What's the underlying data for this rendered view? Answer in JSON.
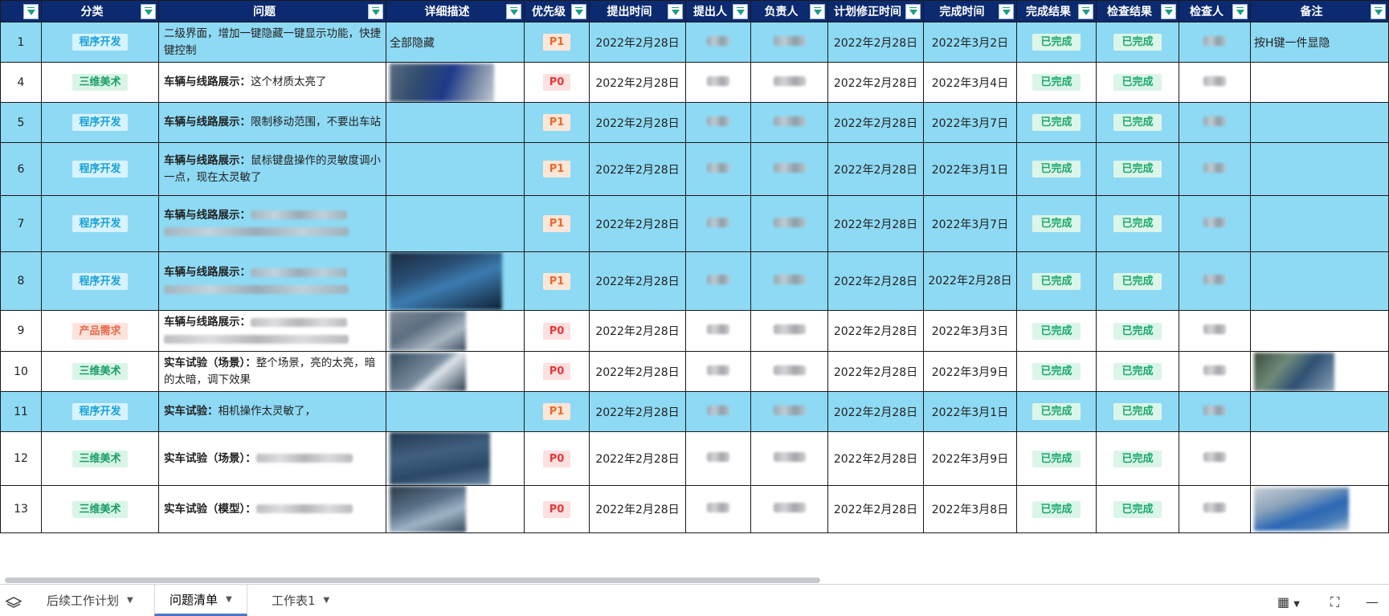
{
  "columns": [
    "",
    "分类",
    "问题",
    "详细描述",
    "优先级",
    "提出时间",
    "提出人",
    "负责人",
    "计划修正时间",
    "完成时间",
    "完成结果",
    "检查结果",
    "检查人",
    "备注"
  ],
  "rows": [
    {
      "no": "1",
      "hl": true,
      "cat": "程序开发",
      "cat_type": "dev",
      "q_bold": "",
      "q_text": "二级界面，增加一键隐藏一键显示功能，快捷键控制",
      "desc": "全部隐藏",
      "pri": "P1",
      "date": "2022年2月28日",
      "plan": "2022年2月28日",
      "finish": "2022年3月2日",
      "result": "已完成",
      "check": "已完成",
      "note": "按H键一件显隐"
    },
    {
      "no": "4",
      "hl": false,
      "cat": "三维美术",
      "cat_type": "art",
      "q_bold": "车辆与线路展示：",
      "q_text": "这个材质太亮了",
      "desc": "",
      "pri": "P0",
      "date": "2022年2月28日",
      "plan": "2022年2月28日",
      "finish": "2022年3月4日",
      "result": "已完成",
      "check": "已完成",
      "note": ""
    },
    {
      "no": "5",
      "hl": true,
      "cat": "程序开发",
      "cat_type": "dev",
      "q_bold": "车辆与线路展示：",
      "q_text": "限制移动范围，不要出车站",
      "desc": "",
      "pri": "P1",
      "date": "2022年2月28日",
      "plan": "2022年2月28日",
      "finish": "2022年3月7日",
      "result": "已完成",
      "check": "已完成",
      "note": ""
    },
    {
      "no": "6",
      "hl": true,
      "cat": "程序开发",
      "cat_type": "dev",
      "q_bold": "车辆与线路展示：",
      "q_text": "鼠标键盘操作的灵敏度调小一点，现在太灵敏了",
      "desc": "",
      "pri": "P1",
      "date": "2022年2月28日",
      "plan": "2022年2月28日",
      "finish": "2022年3月1日",
      "result": "已完成",
      "check": "已完成",
      "note": ""
    },
    {
      "no": "7",
      "hl": true,
      "cat": "程序开发",
      "cat_type": "dev",
      "q_bold": "车辆与线路展示：",
      "q_text": "",
      "desc": "",
      "pri": "P1",
      "date": "2022年2月28日",
      "plan": "2022年2月28日",
      "finish": "2022年3月7日",
      "result": "已完成",
      "check": "已完成",
      "note": ""
    },
    {
      "no": "8",
      "hl": true,
      "cat": "程序开发",
      "cat_type": "dev",
      "q_bold": "车辆与线路展示：",
      "q_text": "",
      "desc": "",
      "pri": "P1",
      "date": "2022年2月28日",
      "plan": "2022年2月28日",
      "finish": "2022年2月28日",
      "result": "已完成",
      "check": "已完成",
      "note": ""
    },
    {
      "no": "9",
      "hl": false,
      "cat": "产品需求",
      "cat_type": "prod",
      "q_bold": "车辆与线路展示：",
      "q_text": "",
      "desc": "",
      "pri": "P0",
      "date": "2022年2月28日",
      "plan": "2022年2月28日",
      "finish": "2022年3月3日",
      "result": "已完成",
      "check": "已完成",
      "note": ""
    },
    {
      "no": "10",
      "hl": false,
      "cat": "三维美术",
      "cat_type": "art",
      "q_bold": "实车试验（场景）：",
      "q_text": "整个场景，亮的太亮，暗的太暗，调下效果",
      "desc": "",
      "pri": "P0",
      "date": "2022年2月28日",
      "plan": "2022年2月28日",
      "finish": "2022年3月9日",
      "result": "已完成",
      "check": "已完成",
      "note": ""
    },
    {
      "no": "11",
      "hl": true,
      "cat": "程序开发",
      "cat_type": "dev",
      "q_bold": "实车试验：",
      "q_text": "相机操作太灵敏了，",
      "desc": "",
      "pri": "P1",
      "date": "2022年2月28日",
      "plan": "2022年2月28日",
      "finish": "2022年3月1日",
      "result": "已完成",
      "check": "已完成",
      "note": ""
    },
    {
      "no": "12",
      "hl": false,
      "cat": "三维美术",
      "cat_type": "art",
      "q_bold": "实车试验（场景）：",
      "q_text": "",
      "desc": "",
      "pri": "P0",
      "date": "2022年2月28日",
      "plan": "2022年2月28日",
      "finish": "2022年3月9日",
      "result": "已完成",
      "check": "已完成",
      "note": ""
    },
    {
      "no": "13",
      "hl": false,
      "cat": "三维美术",
      "cat_type": "art",
      "q_bold": "实车试验（模型）：",
      "q_text": "",
      "desc": "",
      "pri": "P0",
      "date": "2022年2月28日",
      "plan": "2022年2月28日",
      "finish": "2022年3月8日",
      "result": "已完成",
      "check": "已完成",
      "note": ""
    }
  ],
  "tabs": [
    {
      "label": "后续工作计划",
      "active": false
    },
    {
      "label": "问题清单",
      "active": true
    },
    {
      "label": "工作表1",
      "active": false
    }
  ],
  "colors": {
    "header_bg": "#0b2a6f",
    "highlight": "#8edaf4",
    "filter_icon": "#16a085"
  }
}
